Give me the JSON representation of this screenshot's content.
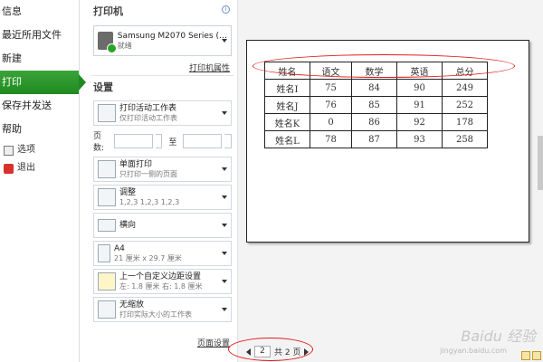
{
  "nav": {
    "items": [
      "信息",
      "最近所用文件",
      "新建",
      "打印",
      "保存并发送",
      "帮助"
    ],
    "small": [
      "选项",
      "退出"
    ],
    "active_index": 3
  },
  "printer": {
    "title": "打印机",
    "name": "Samsung M2070 Series (…",
    "status": "就绪",
    "props_link": "打印机属性"
  },
  "settings": {
    "title": "设置",
    "scope": {
      "main": "打印活动工作表",
      "sub": "仅打印活动工作表"
    },
    "pages_label": "页数:",
    "to_label": "至",
    "sides": {
      "main": "单面打印",
      "sub": "只打印一侧的页面"
    },
    "collate": {
      "main": "调整",
      "sub": "1,2,3    1,2,3    1,2,3"
    },
    "orientation": {
      "main": "横向"
    },
    "paper": {
      "main": "A4",
      "sub": "21 厘米 x 29.7 厘米"
    },
    "margins": {
      "main": "上一个自定义边距设置",
      "sub": "左:  1.8 厘米    右:  1.8 厘米"
    },
    "scale": {
      "main": "无缩放",
      "sub": "打印实际大小的工作表"
    },
    "page_setup_link": "页面设置"
  },
  "sheet": {
    "headers": [
      "姓名",
      "语文",
      "数学",
      "英语",
      "总分"
    ],
    "rows": [
      [
        "姓名I",
        "75",
        "84",
        "90",
        "249"
      ],
      [
        "姓名J",
        "76",
        "85",
        "91",
        "252"
      ],
      [
        "姓名K",
        "0",
        "86",
        "92",
        "178"
      ],
      [
        "姓名L",
        "78",
        "87",
        "93",
        "258"
      ]
    ]
  },
  "pager": {
    "current": "2",
    "total_text": "共 2 页"
  },
  "watermark": {
    "main": "Baidu 经验",
    "sub": "jingyan.baidu.com"
  },
  "colors": {
    "active": "#2a962a",
    "annotation": "#e21b1b"
  }
}
